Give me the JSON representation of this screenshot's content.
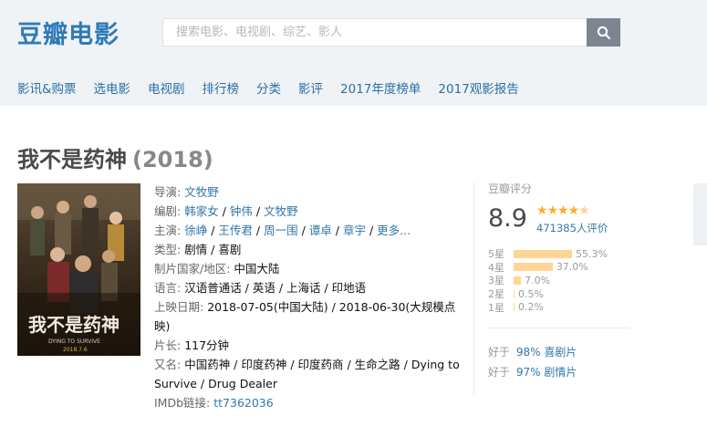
{
  "header": {
    "logo": "豆瓣电影",
    "search_placeholder": "搜索电影、电视剧、综艺、影人",
    "nav": [
      "影讯&购票",
      "选电影",
      "电视剧",
      "排行榜",
      "分类",
      "影评",
      "2017年度榜单",
      "2017观影报告"
    ]
  },
  "movie": {
    "title": "我不是药神",
    "year": "(2018)",
    "poster": {
      "text_main": "我不是药神",
      "text_en": "DYING TO SURVIVE",
      "date": "2018.7.6"
    },
    "info": {
      "director_label": "导演:",
      "director": "文牧野",
      "writer_label": "编剧:",
      "writers": [
        "韩家女",
        "钟伟",
        "文牧野"
      ],
      "cast_label": "主演:",
      "cast": [
        "徐峥",
        "王传君",
        "周一围",
        "谭卓",
        "章宇"
      ],
      "cast_more": "更多...",
      "genre_label": "类型:",
      "genre": "剧情 / 喜剧",
      "country_label": "制片国家/地区:",
      "country": "中国大陆",
      "language_label": "语言:",
      "language": "汉语普通话 / 英语 / 上海话 / 印地语",
      "release_label": "上映日期:",
      "release": "2018-07-05(中国大陆) / 2018-06-30(大规模点映)",
      "runtime_label": "片长:",
      "runtime": "117分钟",
      "aka_label": "又名:",
      "aka": "中国药神 / 印度药神 / 印度药商 / 生命之路 / Dying to Survive / Drug Dealer",
      "imdb_label": "IMDb链接:",
      "imdb": "tt7362036"
    },
    "rating": {
      "label": "豆瓣评分",
      "score": "8.9",
      "stars_value": 4.5,
      "people": "471385人评价",
      "distribution": [
        {
          "label": "5星",
          "pct": "55.3%",
          "value": 55.3
        },
        {
          "label": "4星",
          "pct": "37.0%",
          "value": 37.0
        },
        {
          "label": "3星",
          "pct": "7.0%",
          "value": 7.0
        },
        {
          "label": "2星",
          "pct": "0.5%",
          "value": 0.5
        },
        {
          "label": "1星",
          "pct": "0.2%",
          "value": 0.2
        }
      ],
      "better_than": [
        {
          "prefix": "好于",
          "pct": "98%",
          "genre": "喜剧片"
        },
        {
          "prefix": "好于",
          "pct": "97%",
          "genre": "剧情片"
        }
      ]
    }
  }
}
